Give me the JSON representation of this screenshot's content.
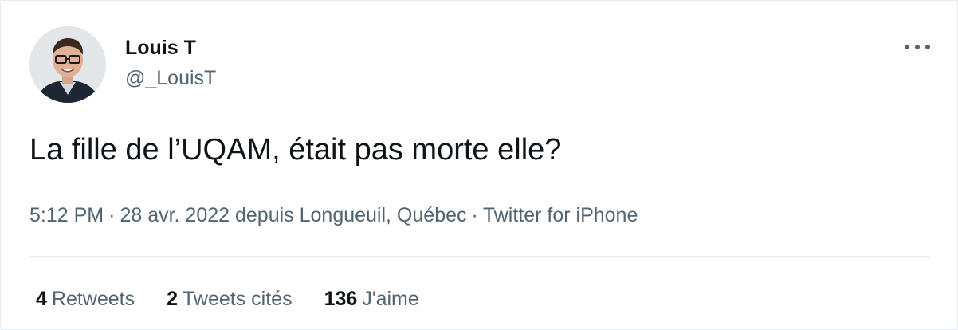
{
  "author": {
    "display_name": "Louis T",
    "handle": "@_LouisT"
  },
  "tweet": {
    "text": "La fille de l’UQAM, était pas morte elle?",
    "time": "5:12 PM",
    "date_place": "28 avr. 2022 depuis Longueuil, Québec",
    "source": "Twitter for iPhone",
    "separator": "·"
  },
  "stats": {
    "retweets_count": "4",
    "retweets_label": "Retweets",
    "quotes_count": "2",
    "quotes_label": "Tweets cités",
    "likes_count": "136",
    "likes_label": "J'aime"
  },
  "icons": {
    "more": "more-horizontal-icon",
    "avatar": "profile-photo"
  },
  "colors": {
    "text_primary": "#0f1419",
    "text_secondary": "#536471",
    "divider": "#e6ecf0"
  }
}
